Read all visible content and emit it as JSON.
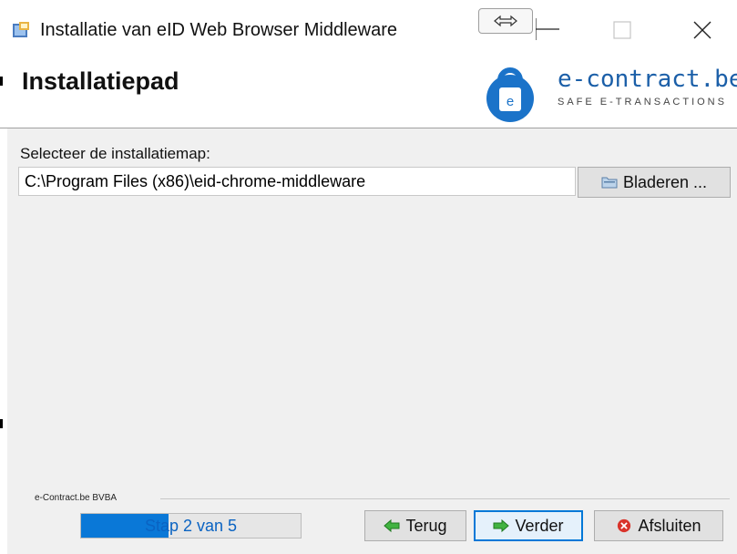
{
  "window": {
    "title": "Installatie van  eID Web Browser Middleware",
    "icons": {
      "app": "installer-icon",
      "snap": "snap-layout-icon",
      "minimize": "minimize-icon",
      "maximize": "maximize-icon",
      "close": "close-icon"
    }
  },
  "header": {
    "title": "Installatiepad",
    "brand": {
      "name": "e-contract.be",
      "tagline": "SAFE E-TRANSACTIONS",
      "logo_icon": "padlock-e-icon"
    }
  },
  "form": {
    "path_label": "Selecteer de installatiemap:",
    "path_value": "C:\\Program Files (x86)\\eid-chrome-middleware",
    "browse_label": "Bladeren ...",
    "browse_icon": "folder-icon"
  },
  "footer": {
    "company": "e-Contract.be BVBA",
    "progress": {
      "text": "Stap 2 van 5",
      "fraction": 0.4
    },
    "buttons": {
      "back": {
        "label": "Terug",
        "icon": "arrow-left-icon"
      },
      "next": {
        "label": "Verder",
        "icon": "arrow-right-icon"
      },
      "exit": {
        "label": "Afsluiten",
        "icon": "cancel-icon"
      }
    }
  },
  "colors": {
    "brand_blue": "#1b5fa8",
    "progress_fill": "#0a78d7",
    "primary_border": "#0078d7",
    "arrow_green": "#2e9e2e",
    "cancel_red": "#d9342b"
  }
}
